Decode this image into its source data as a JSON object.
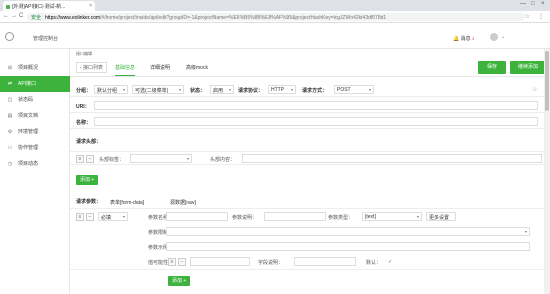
{
  "browser": {
    "tab_title": "[外测]API接口-测试-新...",
    "tab_close": "×",
    "new_tab": "",
    "win_min": "—",
    "win_max": "□",
    "win_close": "×",
    "back": "←",
    "forward": "→",
    "reload": "C",
    "lock": "🔒",
    "secure": "安全",
    "url_host": "https://www.eolinker.com",
    "url_path": "/#/home/project/inside/api/edit?groupID=-1&projectName=%E6%B5%8B%E8%AF%95&projectHashKey=lcgJZWn42kt43df078d1",
    "bookmark": "☆",
    "menu": "⋮"
  },
  "header": {
    "title": "管理控制台",
    "messages": "消息",
    "message_count": "3",
    "user_caret": "⌄"
  },
  "sidebar": {
    "items": [
      {
        "icon": "⊞",
        "label": "项目概况"
      },
      {
        "icon": "⇄",
        "label": "API接口"
      },
      {
        "icon": "◫",
        "label": "状态码"
      },
      {
        "icon": "▤",
        "label": "项目文档"
      },
      {
        "icon": "⚙",
        "label": "环境管理"
      },
      {
        "icon": "⚇",
        "label": "协作管理"
      },
      {
        "icon": "◷",
        "label": "项目动态"
      }
    ]
  },
  "main": {
    "breadcrumb": "接口编辑",
    "back_label": "‹ 接口列表",
    "tabs": [
      "基础信息",
      "详细说明",
      "高级mock"
    ],
    "save_label": "保存",
    "continue_label": "继续添加",
    "group_label": "分组：",
    "group_value": "默认分组",
    "group_sub_value": "可选(二级菜单)",
    "status_label": "状态：",
    "status_value": "启用",
    "protocol_label": "请求协议：",
    "protocol_value": "HTTP",
    "method_label": "请求方式：",
    "method_value": "POST",
    "uri_label": "URI：",
    "name_label": "名称：",
    "req_header_title": "请求头部：",
    "header_tag_label": "头部标签：",
    "header_content_label": "头部内容：",
    "add_label": "添加",
    "req_params_label": "请求参数：",
    "body_tabs": [
      "表单[form-data]",
      "源数据[raw]"
    ],
    "must_fill": "必填",
    "param_name_label": "参数名称：",
    "param_desc_label": "参数说明：",
    "param_type_label": "参数类型：",
    "param_type_value": "[text]",
    "more_settings": "更多设置",
    "param_limit_label": "参数限制：",
    "param_example_label": "参数示例：",
    "value_possible_label": "值可能性：",
    "value_desc_label": "字段说明：",
    "default_label": "默认：",
    "add_label_2": "添加"
  }
}
